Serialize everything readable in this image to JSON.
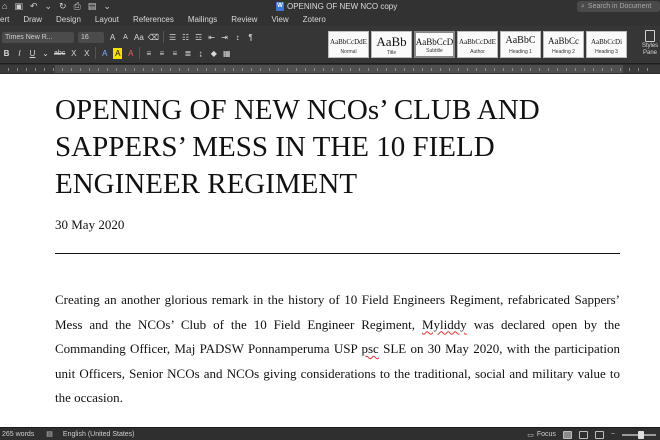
{
  "window": {
    "title": "OPENING OF NEW NCO copy",
    "doc_icon_letter": "W",
    "search_placeholder": "Search in Document"
  },
  "menu": {
    "tabs": [
      "ert",
      "Draw",
      "Design",
      "Layout",
      "References",
      "Mailings",
      "Review",
      "View",
      "Zotero"
    ]
  },
  "ribbon": {
    "font_name": "Times New R...",
    "font_size": "16",
    "grow_font": "A",
    "shrink_font": "A",
    "change_case": "Aa",
    "bold": "B",
    "italic": "I",
    "underline": "U",
    "strikethrough": "abc",
    "subscript": "X",
    "superscript": "X",
    "text_effects": "A",
    "highlight": "A",
    "font_color": "A",
    "styles": [
      {
        "sample": "AaBbCcDdE",
        "name": "Normal"
      },
      {
        "sample": "AaBb",
        "name": "Title"
      },
      {
        "sample": "AaBbCcD",
        "name": "Subtitle"
      },
      {
        "sample": "AaBbCcDdE",
        "name": "Author"
      },
      {
        "sample": "AaBbC",
        "name": "Heading 1"
      },
      {
        "sample": "AaBbCc",
        "name": "Heading 2"
      },
      {
        "sample": "AaBbCcDi",
        "name": "Heading 3"
      }
    ],
    "styles_pane_label_1": "Styles",
    "styles_pane_label_2": "Pane"
  },
  "document": {
    "title": "OPENING OF NEW NCOs’ CLUB AND SAPPERS’ MESS IN THE 10 FIELD ENGINEER REGIMENT",
    "date": "30 May 2020",
    "body_part1": "Creating an another glorious remark in the history of 10 Field Engineers Regiment, refabricated Sappers’ Mess and the  NCOs’ Club of the 10 Field Engineer Regiment, ",
    "body_misspelled_1": "Myliddy",
    "body_part2": " was declared open by the  Commanding Officer, Maj PADSW Ponnamperuma USP ",
    "body_misspelled_2": "psc",
    "body_part3": " SLE on 30 May 2020, with the participation unit Officers, Senior NCOs and NCOs giving considerations to the traditional, social and military value to the occasion."
  },
  "status": {
    "word_count": "265 words",
    "language": "English (United States)",
    "focus": "Focus"
  }
}
